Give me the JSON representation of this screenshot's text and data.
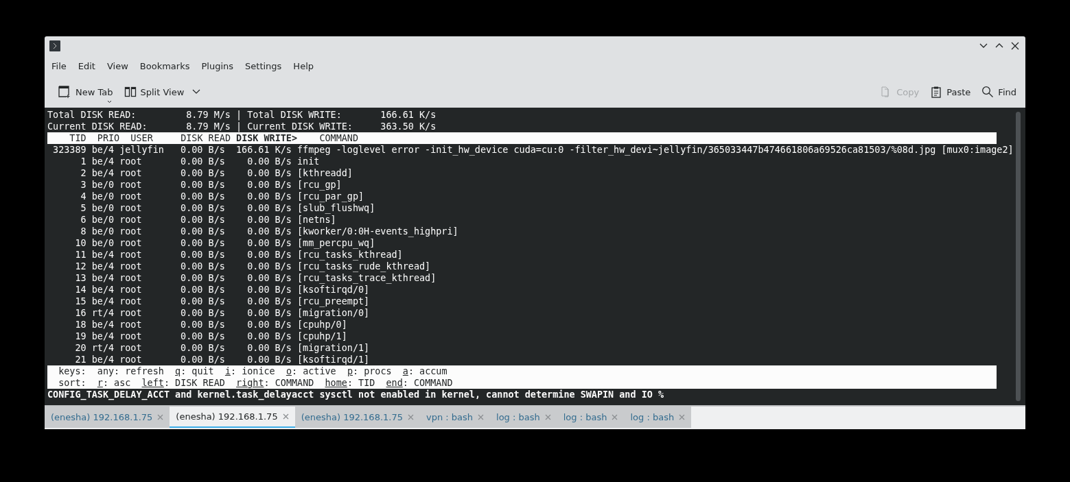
{
  "menu": [
    {
      "label": "File"
    },
    {
      "label": "Edit"
    },
    {
      "label": "View"
    },
    {
      "label": "Bookmarks"
    },
    {
      "label": "Plugins"
    },
    {
      "label": "Settings"
    },
    {
      "label": "Help"
    }
  ],
  "toolbar_left": [
    {
      "kind": "newtab",
      "label": "New Tab",
      "disabled": false
    },
    {
      "kind": "split",
      "label": "Split View",
      "disabled": false
    }
  ],
  "toolbar_right": [
    {
      "kind": "copy",
      "label": "Copy",
      "disabled": true
    },
    {
      "kind": "paste",
      "label": "Paste",
      "disabled": false
    },
    {
      "kind": "find",
      "label": "Find",
      "disabled": false
    }
  ],
  "terminal": {
    "totals": [
      {
        "label1": "Total DISK READ:",
        "value1": "8.79 M/s",
        "separator": "|",
        "label2": "Total DISK WRITE:",
        "value2": "166.61 K/s"
      },
      {
        "label1": "Current DISK READ:",
        "value1": "8.79 M/s",
        "separator": "|",
        "label2": "Current DISK WRITE:",
        "value2": "363.50 K/s"
      }
    ],
    "columns": [
      {
        "label": "TID",
        "sorted": false
      },
      {
        "label": "PRIO",
        "sorted": false
      },
      {
        "label": "USER",
        "sorted": false
      },
      {
        "label": "DISK READ",
        "sorted": false
      },
      {
        "label": "DISK WRITE>",
        "sorted": true
      },
      {
        "label": "COMMAND",
        "sorted": false
      }
    ],
    "rows": [
      [
        "323389",
        "be/4",
        "jellyfin",
        "0.00 B/s",
        "166.61 K/s",
        "ffmpeg -loglevel error -init_hw_device cuda=cu:0 -filter_hw_devi~jellyfin/365033447b474661806a69526ca81503/%08d.jpg [mux0:image2]"
      ],
      [
        "1",
        "be/4",
        "root",
        "0.00 B/s",
        "0.00 B/s",
        "init"
      ],
      [
        "2",
        "be/4",
        "root",
        "0.00 B/s",
        "0.00 B/s",
        "[kthreadd]"
      ],
      [
        "3",
        "be/0",
        "root",
        "0.00 B/s",
        "0.00 B/s",
        "[rcu_gp]"
      ],
      [
        "4",
        "be/0",
        "root",
        "0.00 B/s",
        "0.00 B/s",
        "[rcu_par_gp]"
      ],
      [
        "5",
        "be/0",
        "root",
        "0.00 B/s",
        "0.00 B/s",
        "[slub_flushwq]"
      ],
      [
        "6",
        "be/0",
        "root",
        "0.00 B/s",
        "0.00 B/s",
        "[netns]"
      ],
      [
        "8",
        "be/0",
        "root",
        "0.00 B/s",
        "0.00 B/s",
        "[kworker/0:0H-events_highpri]"
      ],
      [
        "10",
        "be/0",
        "root",
        "0.00 B/s",
        "0.00 B/s",
        "[mm_percpu_wq]"
      ],
      [
        "11",
        "be/4",
        "root",
        "0.00 B/s",
        "0.00 B/s",
        "[rcu_tasks_kthread]"
      ],
      [
        "12",
        "be/4",
        "root",
        "0.00 B/s",
        "0.00 B/s",
        "[rcu_tasks_rude_kthread]"
      ],
      [
        "13",
        "be/4",
        "root",
        "0.00 B/s",
        "0.00 B/s",
        "[rcu_tasks_trace_kthread]"
      ],
      [
        "14",
        "be/4",
        "root",
        "0.00 B/s",
        "0.00 B/s",
        "[ksoftirqd/0]"
      ],
      [
        "15",
        "be/4",
        "root",
        "0.00 B/s",
        "0.00 B/s",
        "[rcu_preempt]"
      ],
      [
        "16",
        "rt/4",
        "root",
        "0.00 B/s",
        "0.00 B/s",
        "[migration/0]"
      ],
      [
        "18",
        "be/4",
        "root",
        "0.00 B/s",
        "0.00 B/s",
        "[cpuhp/0]"
      ],
      [
        "19",
        "be/4",
        "root",
        "0.00 B/s",
        "0.00 B/s",
        "[cpuhp/1]"
      ],
      [
        "20",
        "rt/4",
        "root",
        "0.00 B/s",
        "0.00 B/s",
        "[migration/1]"
      ],
      [
        "21",
        "be/4",
        "root",
        "0.00 B/s",
        "0.00 B/s",
        "[ksoftirqd/1]"
      ]
    ],
    "help_lines": [
      {
        "label": "keys:",
        "items": [
          {
            "key": "any",
            "underlined": false,
            "delimiter": ":",
            "action": "refresh"
          },
          {
            "key": "q",
            "underlined": true,
            "delimiter": ":",
            "action": "quit"
          },
          {
            "key": "i",
            "underlined": true,
            "delimiter": ":",
            "action": "ionice"
          },
          {
            "key": "o",
            "underlined": true,
            "delimiter": ":",
            "action": "active"
          },
          {
            "key": "p",
            "underlined": true,
            "delimiter": ":",
            "action": "procs"
          },
          {
            "key": "a",
            "underlined": true,
            "delimiter": ":",
            "action": "accum"
          }
        ]
      },
      {
        "label": "sort:",
        "items": [
          {
            "key": "r",
            "underlined": true,
            "delimiter": ":",
            "action": "asc"
          },
          {
            "key": "left",
            "underlined": true,
            "delimiter": ":",
            "action": "DISK READ"
          },
          {
            "key": "right",
            "underlined": true,
            "delimiter": ":",
            "action": "COMMAND"
          },
          {
            "key": "home",
            "underlined": true,
            "delimiter": ":",
            "action": "TID"
          },
          {
            "key": "end",
            "underlined": true,
            "delimiter": ":",
            "action": "COMMAND"
          }
        ]
      }
    ],
    "message": "CONFIG_TASK_DELAY_ACCT and kernel.task_delayacct sysctl not enabled in kernel, cannot determine SWAPIN and IO %"
  },
  "tabs": [
    {
      "label": "(enesha) 192.168.1.75",
      "selected": false
    },
    {
      "label": "(enesha) 192.168.1.75",
      "selected": true
    },
    {
      "label": "(enesha) 192.168.1.75",
      "selected": false
    },
    {
      "label": "vpn : bash",
      "selected": false
    },
    {
      "label": "log : bash",
      "selected": false
    },
    {
      "label": "log : bash",
      "selected": false
    },
    {
      "label": "log : bash",
      "selected": false
    }
  ]
}
